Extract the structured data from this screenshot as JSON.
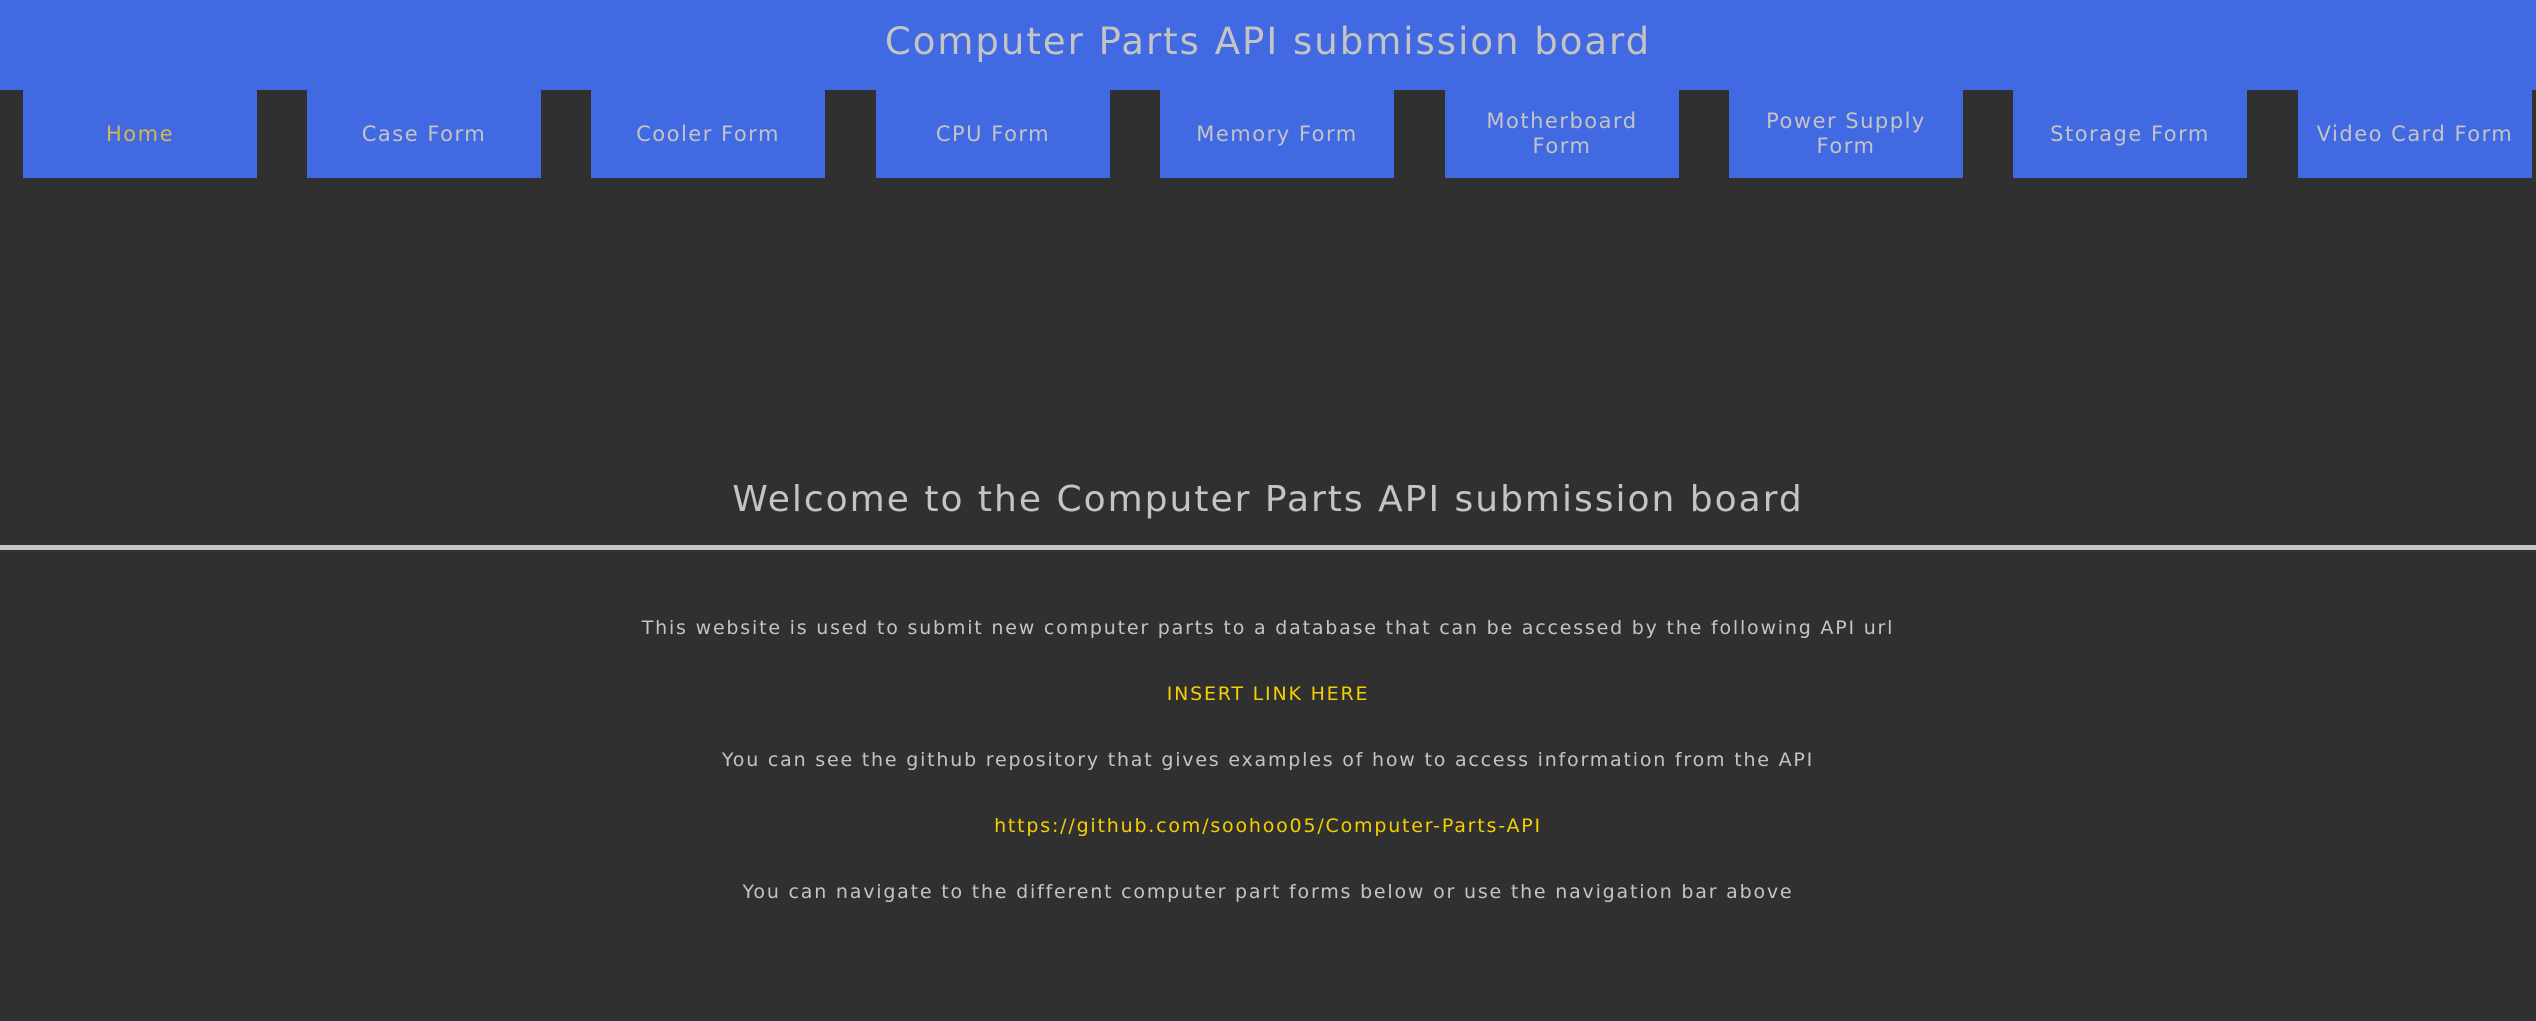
{
  "header": {
    "title": "Computer Parts API submission board"
  },
  "nav": {
    "items": [
      {
        "label": "Home",
        "active": true
      },
      {
        "label": "Case Form"
      },
      {
        "label": "Cooler Form"
      },
      {
        "label": "CPU Form"
      },
      {
        "label": "Memory Form"
      },
      {
        "label": "Motherboard Form"
      },
      {
        "label": "Power Supply Form"
      },
      {
        "label": "Storage Form"
      },
      {
        "label": "Video Card Form"
      }
    ]
  },
  "main": {
    "heading": "Welcome to the Computer Parts API submission board",
    "intro_text": "This website is used to submit new computer parts to a database that can be accessed by the following API url",
    "api_link_text": "INSERT LINK HERE",
    "github_text": "You can see the github repository that gives examples of how to access information from the API",
    "github_link_text": "https://github.com/soohoo05/Computer-Parts-API",
    "navigate_text": "You can navigate to the different computer part forms below or use the navigation bar above"
  },
  "colors": {
    "banner": "#4169e1",
    "background": "#303030",
    "text": "#c4c4c4",
    "active_nav": "#d4b84a",
    "link": "#f5d000"
  }
}
